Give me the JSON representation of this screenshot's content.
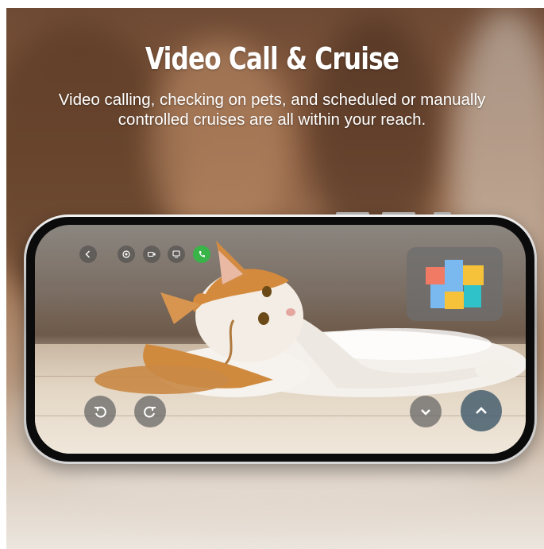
{
  "header": {
    "title": "Video Call & Cruise",
    "subtitle": "Video calling, checking on pets, and scheduled or manually controlled cruises are all within your reach."
  },
  "app_screen": {
    "toolbar_icons": [
      "back-chevron-icon",
      "settings-icon",
      "record-video-icon",
      "cruise-mode-icon",
      "phone-call-icon"
    ],
    "map_card_colors": [
      "#f07a63",
      "#7ab9f0",
      "#f5c23a",
      "#2fc2c9"
    ],
    "rotate_icons": [
      "rotate-left-icon",
      "rotate-right-icon"
    ],
    "tilt_icons": [
      "chevron-down-icon",
      "chevron-up-icon"
    ]
  },
  "colors": {
    "call_green": "#38b449",
    "text": "#ffffff"
  }
}
